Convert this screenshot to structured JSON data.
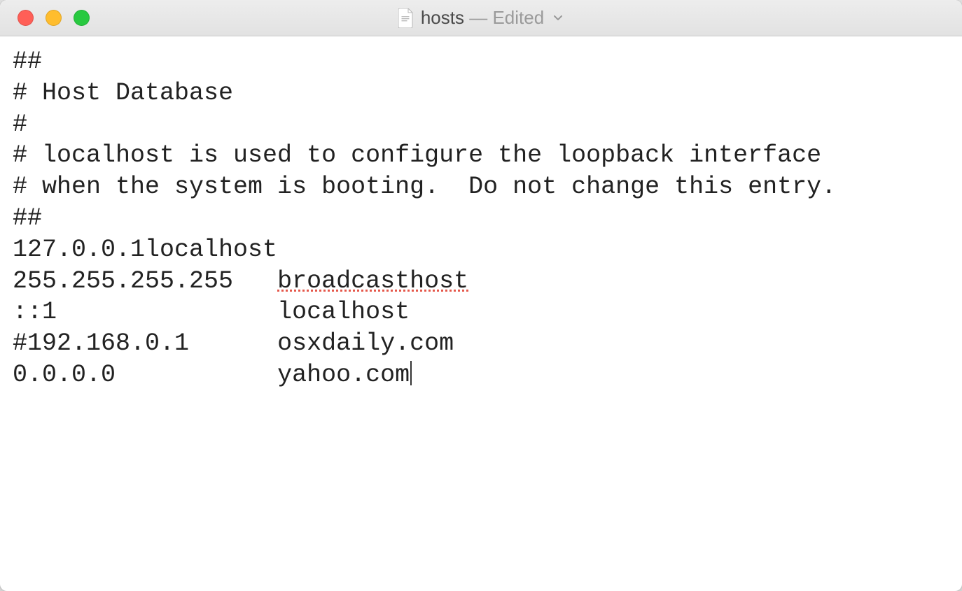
{
  "window": {
    "filename": "hosts",
    "status_separator": " — ",
    "status": "Edited"
  },
  "file": {
    "lines": [
      "##",
      "# Host Database",
      "#",
      "# localhost is used to configure the loopback interface",
      "# when the system is booting.  Do not change this entry.",
      "##"
    ],
    "row_local_ip": "127.0.0.1",
    "row_local_host": "localhost",
    "row_broadcast_ip": "255.255.255.255",
    "row_broadcast_host": "broadcasthost",
    "row_ipv6_ip": "::1",
    "row_ipv6_host": "localhost",
    "row_comment_ip": "#192.168.0.1",
    "row_comment_host": "osxdaily.com",
    "row_zero_ip": "0.0.0.0",
    "row_zero_host": "yahoo.com",
    "tab": "   "
  }
}
